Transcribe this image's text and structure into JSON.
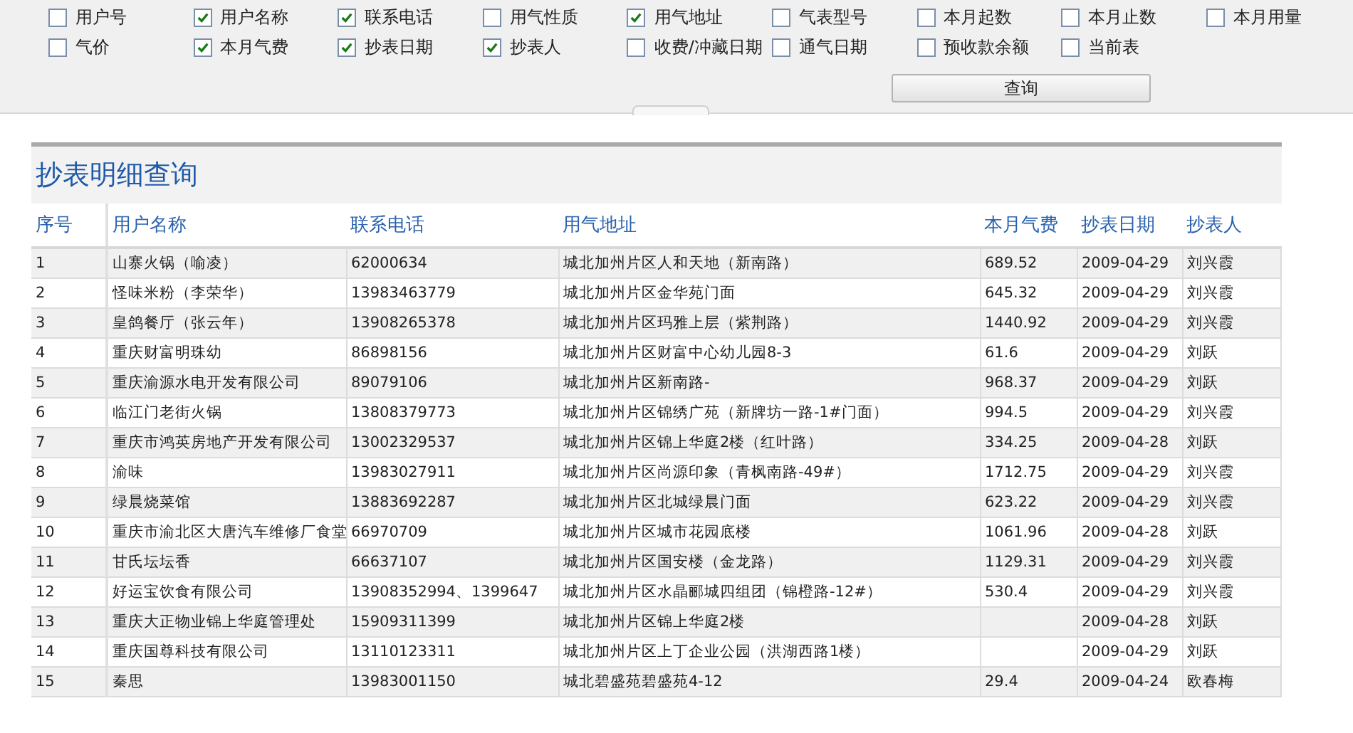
{
  "filters": [
    {
      "label": "用户号",
      "checked": false
    },
    {
      "label": "用户名称",
      "checked": true
    },
    {
      "label": "联系电话",
      "checked": true
    },
    {
      "label": "用气性质",
      "checked": false
    },
    {
      "label": "用气地址",
      "checked": true
    },
    {
      "label": "气表型号",
      "checked": false
    },
    {
      "label": "本月起数",
      "checked": false
    },
    {
      "label": "本月止数",
      "checked": false
    },
    {
      "label": "本月用量",
      "checked": false
    },
    {
      "label": "气价",
      "checked": false
    },
    {
      "label": "本月气费",
      "checked": true
    },
    {
      "label": "抄表日期",
      "checked": true
    },
    {
      "label": "抄表人",
      "checked": true
    },
    {
      "label": "收费/冲藏日期",
      "checked": false
    },
    {
      "label": "通气日期",
      "checked": false
    },
    {
      "label": "预收款余额",
      "checked": false
    },
    {
      "label": "当前表",
      "checked": false
    }
  ],
  "query_button": "查询",
  "report": {
    "title": "抄表明细查询",
    "columns": [
      "序号",
      "用户名称",
      "联系电话",
      "用气地址",
      "本月气费",
      "抄表日期",
      "抄表人"
    ],
    "rows": [
      [
        "1",
        "山寨火锅（喻凌）",
        "62000634",
        "城北加州片区人和天地（新南路）",
        "689.52",
        "2009-04-29",
        "刘兴霞"
      ],
      [
        "2",
        "怪味米粉（李荣华）",
        "13983463779",
        "城北加州片区金华苑门面",
        "645.32",
        "2009-04-29",
        "刘兴霞"
      ],
      [
        "3",
        "皇鸽餐厅（张云年）",
        "13908265378",
        "城北加州片区玛雅上层（紫荆路）",
        "1440.92",
        "2009-04-29",
        "刘兴霞"
      ],
      [
        "4",
        "重庆财富明珠幼",
        "86898156",
        "城北加州片区财富中心幼儿园8-3",
        "61.6",
        "2009-04-29",
        "刘跃"
      ],
      [
        "5",
        "重庆渝源水电开发有限公司",
        "89079106",
        "城北加州片区新南路-",
        "968.37",
        "2009-04-29",
        "刘跃"
      ],
      [
        "6",
        "临江门老街火锅",
        "13808379773",
        "城北加州片区锦绣广苑（新牌坊一路-1#门面）",
        "994.5",
        "2009-04-29",
        "刘兴霞"
      ],
      [
        "7",
        "重庆市鸿英房地产开发有限公司",
        "13002329537",
        "城北加州片区锦上华庭2楼（红叶路）",
        "334.25",
        "2009-04-28",
        "刘跃"
      ],
      [
        "8",
        "渝味",
        "13983027911",
        "城北加州片区尚源印象（青枫南路-49#）",
        "1712.75",
        "2009-04-29",
        "刘兴霞"
      ],
      [
        "9",
        "绿晨烧菜馆",
        "13883692287",
        "城北加州片区北城绿晨门面",
        "623.22",
        "2009-04-29",
        "刘兴霞"
      ],
      [
        "10",
        "重庆市渝北区大唐汽车维修厂食堂",
        "66970709",
        "城北加州片区城市花园底楼",
        "1061.96",
        "2009-04-28",
        "刘跃"
      ],
      [
        "11",
        "甘氏坛坛香",
        "66637107",
        "城北加州片区国安楼（金龙路）",
        "1129.31",
        "2009-04-29",
        "刘兴霞"
      ],
      [
        "12",
        "好运宝饮食有限公司",
        "13908352994、1399647",
        "城北加州片区水晶郦城四组团（锦橙路-12#）",
        "530.4",
        "2009-04-29",
        "刘兴霞"
      ],
      [
        "13",
        "重庆大正物业锦上华庭管理处",
        "15909311399",
        "城北加州片区锦上华庭2楼",
        "",
        "2009-04-28",
        "刘跃"
      ],
      [
        "14",
        "重庆国尊科技有限公司",
        "13110123311",
        "城北加州片区上丁企业公园（洪湖西路1楼）",
        "",
        "2009-04-29",
        "刘跃"
      ],
      [
        "15",
        "秦思",
        "13983001150",
        "城北碧盛苑碧盛苑4-12",
        "29.4",
        "2009-04-24",
        "欧春梅"
      ]
    ]
  }
}
